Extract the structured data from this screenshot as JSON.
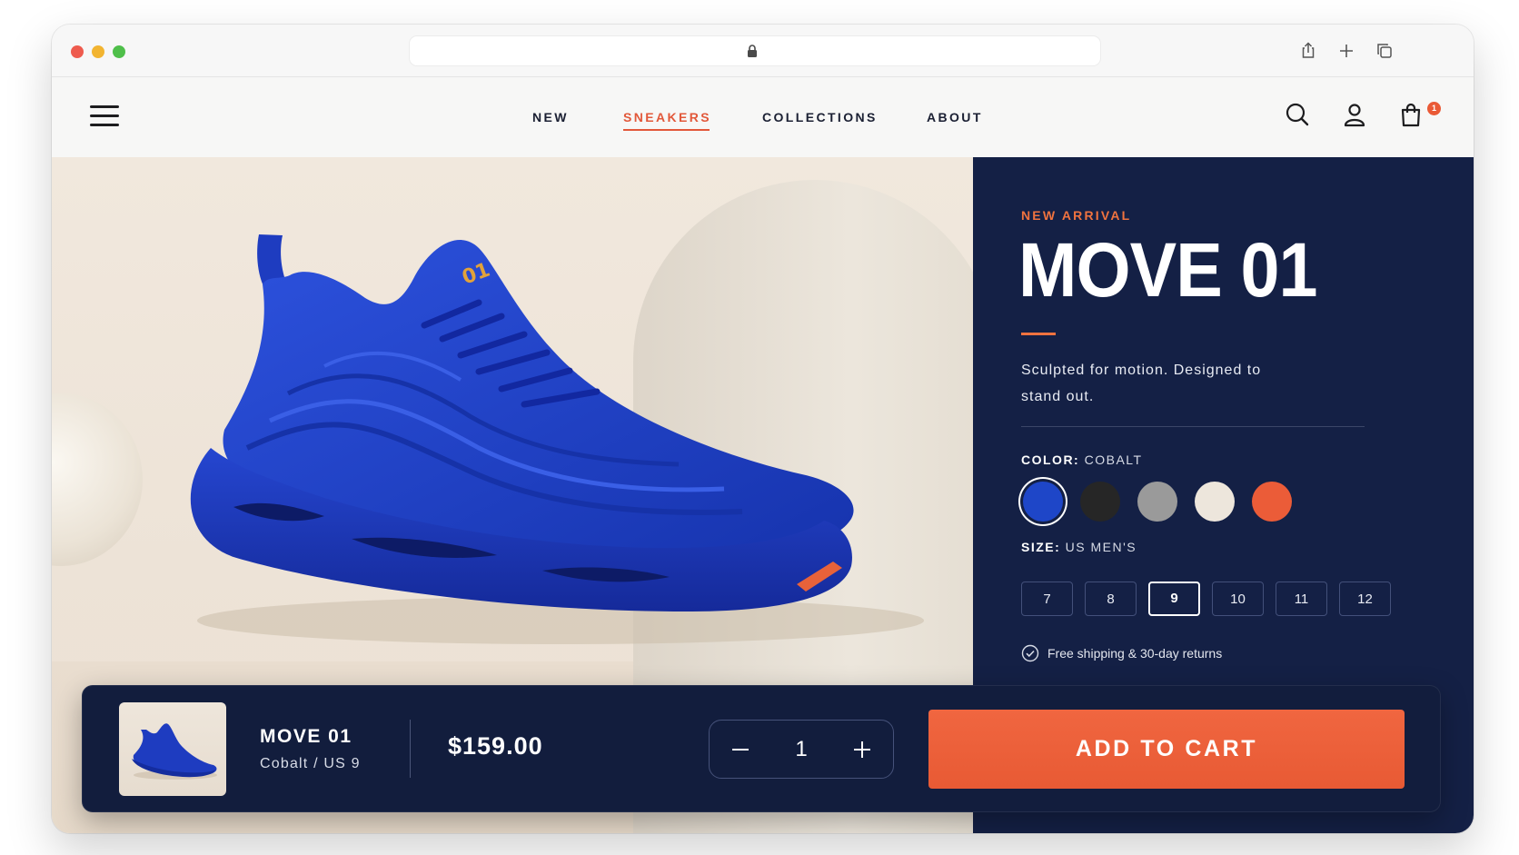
{
  "nav": {
    "links": [
      {
        "label": "NEW"
      },
      {
        "label": "SNEAKERS"
      },
      {
        "label": "COLLECTIONS"
      },
      {
        "label": "ABOUT"
      }
    ],
    "active": "SNEAKERS",
    "cart_count": "1"
  },
  "product": {
    "eyebrow": "NEW ARRIVAL",
    "title": "MOVE 01",
    "tagline": "Sculpted for motion. Designed to stand out.",
    "color_label": "COLOR:",
    "color_value": "COBALT",
    "colors": [
      {
        "name": "cobalt",
        "hex": "#1e46c8"
      },
      {
        "name": "black",
        "hex": "#262626"
      },
      {
        "name": "gray",
        "hex": "#9a9a9a"
      },
      {
        "name": "cream",
        "hex": "#ede6dc"
      },
      {
        "name": "orange",
        "hex": "#eb5c38"
      }
    ],
    "selected_color": "cobalt",
    "size_label": "SIZE:",
    "size_value": "US MEN'S",
    "sizes": [
      "7",
      "8",
      "9",
      "10",
      "11",
      "12"
    ],
    "selected_size": "9",
    "shipping": "Free shipping & 30-day returns"
  },
  "cart_bar": {
    "name": "MOVE 01",
    "variant": "Cobalt / US 9",
    "price": "$159.00",
    "quantity": "1",
    "add_label": "ADD TO CART"
  },
  "colors": {
    "accent": "#e9603a",
    "panel": "#142045",
    "shoe": "#1e3cc0"
  }
}
